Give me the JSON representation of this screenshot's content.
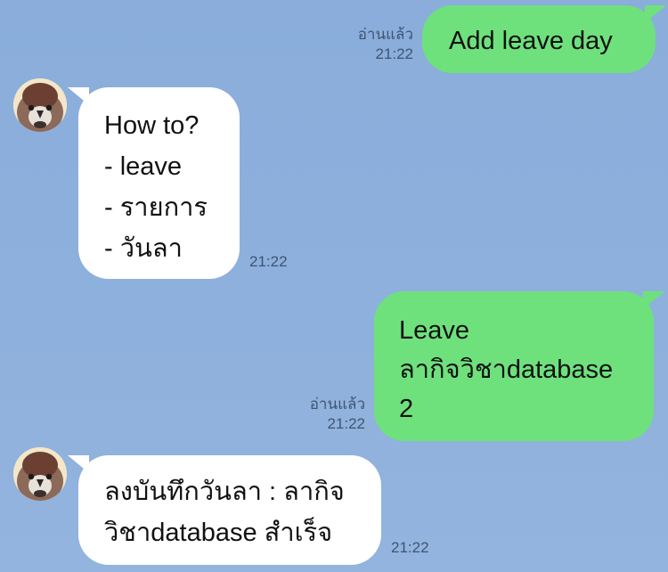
{
  "messages": [
    {
      "direction": "outgoing",
      "lines": [
        "Add leave day"
      ],
      "read_status": "อ่านแล้ว",
      "time": "21:22"
    },
    {
      "direction": "incoming",
      "lines": [
        "How to?",
        "- leave",
        "- รายการ",
        "- วันลา"
      ],
      "time": "21:22"
    },
    {
      "direction": "outgoing",
      "lines": [
        "Leave",
        "ลากิจวิชาdatabase",
        "2"
      ],
      "read_status": "อ่านแล้ว",
      "time": "21:22"
    },
    {
      "direction": "incoming",
      "lines": [
        "ลงบันทึกวันลา : ลากิจ",
        "วิชาdatabase สำเร็จ"
      ],
      "time": "21:22"
    }
  ],
  "colors": {
    "background": "#8eb0dc",
    "outgoing_bubble": "#6ee17c",
    "incoming_bubble": "#ffffff",
    "meta_text": "#3f5572"
  },
  "icons": {
    "avatar": "sparrow-avatar-icon"
  }
}
